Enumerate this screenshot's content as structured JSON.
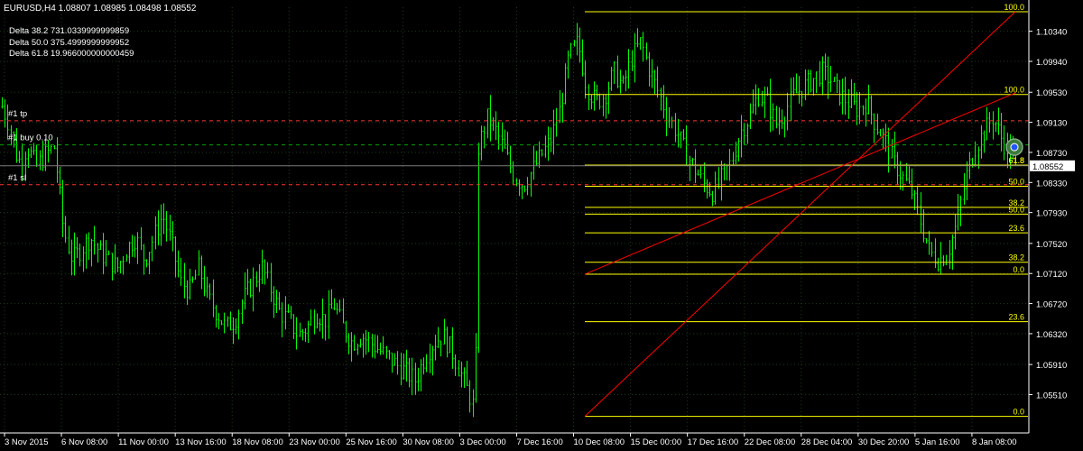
{
  "symbol_header": "EURUSD,H4  1.08807 1.08985 1.08498 1.08552",
  "deltas": [
    "Delta 38.2 731.0339999999859",
    "Delta 50.0 375.4999999999952",
    "Delta 61.8 19.966000000000459"
  ],
  "trade_lines": [
    {
      "label": "#1 tp",
      "price": 1.0915
    },
    {
      "label": "#1 buy 0.10",
      "price": 1.0883
    },
    {
      "label": "#1 sl",
      "price": 1.083
    }
  ],
  "current_price": {
    "label": "1.08552",
    "value": 1.08552
  },
  "price_axis": {
    "min": 1.05,
    "max": 1.1066,
    "ticks": [
      "1.10340",
      "1.09940",
      "1.09530",
      "1.09130",
      "1.08730",
      "1.08330",
      "1.07930",
      "1.07520",
      "1.07120",
      "1.06720",
      "1.06320",
      "1.05910",
      "1.05510"
    ]
  },
  "time_axis": {
    "labels": [
      "3 Nov 2015",
      "6 Nov 08:00",
      "11 Nov 00:00",
      "13 Nov 16:00",
      "18 Nov 08:00",
      "23 Nov 00:00",
      "25 Nov 16:00",
      "30 Nov 08:00",
      "3 Dec 00:00",
      "7 Dec 16:00",
      "10 Dec 08:00",
      "15 Dec 00:00",
      "17 Dec 16:00",
      "22 Dec 08:00",
      "28 Dec 04:00",
      "30 Dec 20:00",
      "5 Jan 16:00",
      "8 Jan 08:00"
    ]
  },
  "fib_sets": [
    {
      "name": "fib-upper",
      "levels": [
        {
          "label": "100.0",
          "price": 1.106
        },
        {
          "label": "100.0",
          "price": 1.095
        },
        {
          "label": "61.8",
          "price": 1.0856
        },
        {
          "label": "50.0",
          "price": 1.0828
        },
        {
          "label": "38.2",
          "price": 1.08
        },
        {
          "label": "23.6",
          "price": 1.0766
        },
        {
          "label": "0.0",
          "price": 1.0711
        }
      ]
    },
    {
      "name": "fib-lower",
      "levels": [
        {
          "label": "61.8",
          "price": 1.0856
        },
        {
          "label": "50.0",
          "price": 1.0791
        },
        {
          "label": "38.2",
          "price": 1.0727
        },
        {
          "label": "23.6",
          "price": 1.0648
        },
        {
          "label": "0.0",
          "price": 1.0522
        }
      ]
    }
  ],
  "colors": {
    "background": "#000000",
    "candle": "#00ff00",
    "grid": "#1b3a1b",
    "fib": "#ffff00",
    "level_red": "#ff3333",
    "trade_green": "#00a000",
    "trend": "#ff0000",
    "text": "#ffffff"
  },
  "chart_data": {
    "type": "candlestick",
    "symbol": "EURUSD",
    "timeframe": "H4",
    "last": {
      "open": 1.08807,
      "high": 1.08985,
      "low": 1.08498,
      "close": 1.08552
    },
    "ylim": [
      1.05,
      1.1066
    ],
    "close_path": [
      [
        0,
        1.094
      ],
      [
        10,
        1.091
      ],
      [
        20,
        1.086
      ],
      [
        30,
        1.088
      ],
      [
        40,
        1.0855
      ],
      [
        50,
        1.087
      ],
      [
        60,
        1.088
      ],
      [
        70,
        1.077
      ],
      [
        80,
        1.073
      ],
      [
        90,
        1.0745
      ],
      [
        100,
        1.076
      ],
      [
        110,
        1.074
      ],
      [
        120,
        1.073
      ],
      [
        130,
        1.072
      ],
      [
        140,
        1.0745
      ],
      [
        150,
        1.076
      ],
      [
        160,
        1.073
      ],
      [
        170,
        1.076
      ],
      [
        180,
        1.079
      ],
      [
        190,
        1.075
      ],
      [
        200,
        1.07
      ],
      [
        210,
        1.069
      ],
      [
        220,
        1.072
      ],
      [
        230,
        1.068
      ],
      [
        240,
        1.066
      ],
      [
        250,
        1.064
      ],
      [
        260,
        1.065
      ],
      [
        270,
        1.068
      ],
      [
        280,
        1.07
      ],
      [
        290,
        1.072
      ],
      [
        300,
        1.069
      ],
      [
        310,
        1.066
      ],
      [
        320,
        1.065
      ],
      [
        330,
        1.063
      ],
      [
        340,
        1.064
      ],
      [
        350,
        1.066
      ],
      [
        360,
        1.065
      ],
      [
        370,
        1.067
      ],
      [
        380,
        1.064
      ],
      [
        390,
        1.062
      ],
      [
        400,
        1.063
      ],
      [
        410,
        1.062
      ],
      [
        420,
        1.061
      ],
      [
        430,
        1.06
      ],
      [
        440,
        1.059
      ],
      [
        450,
        1.058
      ],
      [
        460,
        1.057
      ],
      [
        470,
        1.06
      ],
      [
        480,
        1.062
      ],
      [
        490,
        1.063
      ],
      [
        500,
        1.061
      ],
      [
        510,
        1.058
      ],
      [
        520,
        1.055
      ],
      [
        526,
        1.053
      ],
      [
        530,
        1.088
      ],
      [
        540,
        1.092
      ],
      [
        550,
        1.09
      ],
      [
        560,
        1.087
      ],
      [
        570,
        1.084
      ],
      [
        580,
        1.083
      ],
      [
        590,
        1.085
      ],
      [
        600,
        1.087
      ],
      [
        610,
        1.089
      ],
      [
        620,
        1.093
      ],
      [
        630,
        1.1
      ],
      [
        640,
        1.102
      ],
      [
        650,
        1.096
      ],
      [
        660,
        1.094
      ],
      [
        670,
        1.095
      ],
      [
        680,
        1.098
      ],
      [
        690,
        1.096
      ],
      [
        700,
        1.1
      ],
      [
        710,
        1.102
      ],
      [
        720,
        1.098
      ],
      [
        730,
        1.095
      ],
      [
        740,
        1.092
      ],
      [
        750,
        1.09
      ],
      [
        760,
        1.087
      ],
      [
        770,
        1.085
      ],
      [
        780,
        1.083
      ],
      [
        790,
        1.082
      ],
      [
        800,
        1.084
      ],
      [
        810,
        1.086
      ],
      [
        820,
        1.09
      ],
      [
        830,
        1.092
      ],
      [
        840,
        1.095
      ],
      [
        850,
        1.094
      ],
      [
        860,
        1.091
      ],
      [
        870,
        1.093
      ],
      [
        880,
        1.095
      ],
      [
        890,
        1.096
      ],
      [
        900,
        1.097
      ],
      [
        910,
        1.098
      ],
      [
        920,
        1.097
      ],
      [
        930,
        1.095
      ],
      [
        940,
        1.094
      ],
      [
        950,
        1.093
      ],
      [
        960,
        1.094
      ],
      [
        970,
        1.091
      ],
      [
        980,
        1.089
      ],
      [
        990,
        1.086
      ],
      [
        1000,
        1.084
      ],
      [
        1010,
        1.082
      ],
      [
        1020,
        1.078
      ],
      [
        1030,
        1.074
      ],
      [
        1040,
        1.073
      ],
      [
        1050,
        1.074
      ],
      [
        1060,
        1.078
      ],
      [
        1070,
        1.084
      ],
      [
        1080,
        1.088
      ],
      [
        1090,
        1.09
      ],
      [
        1100,
        1.092
      ],
      [
        1110,
        1.089
      ],
      [
        1120,
        1.087
      ],
      [
        1130,
        1.0855
      ]
    ]
  }
}
